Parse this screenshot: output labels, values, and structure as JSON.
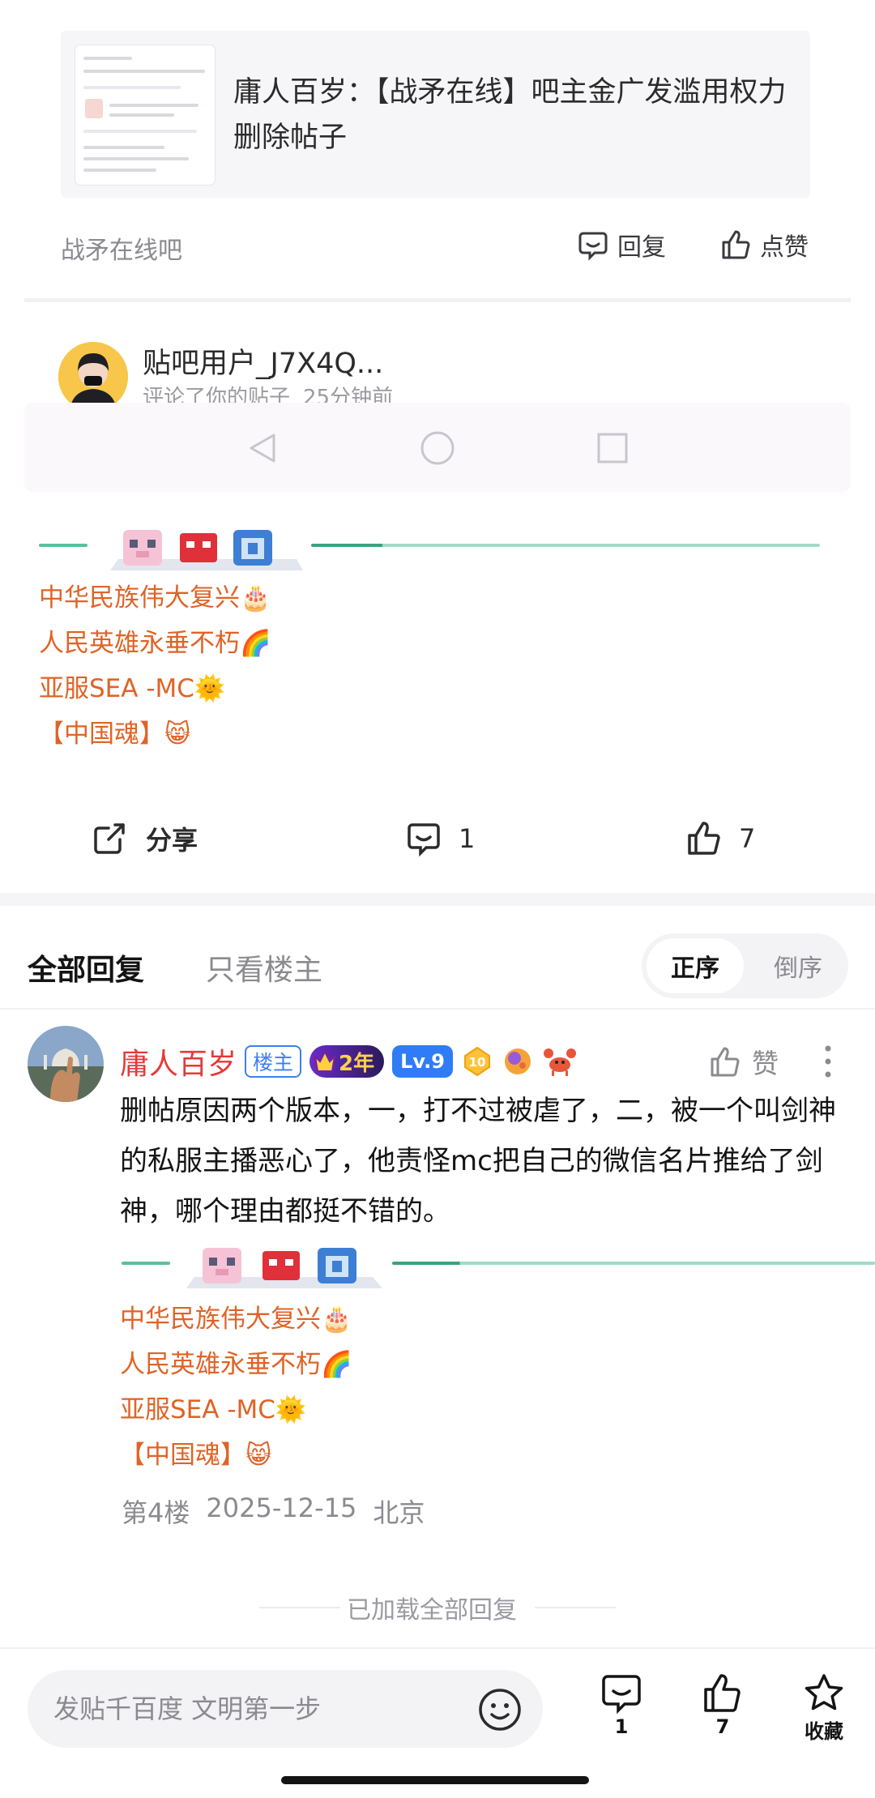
{
  "quoted_post": {
    "title": "庸人百岁：【战矛在线】吧主金广发滥用权力删除帖子",
    "forum": "战矛在线吧",
    "reply_label": "回复",
    "like_label": "点赞"
  },
  "notification": {
    "username": "贴吧用户_J7X4Q...",
    "action": "评论了你的贴子",
    "time": "25分钟前"
  },
  "signature": {
    "line1": "中华民族伟大复兴🎂",
    "line2": "人民英雄永垂不朽🌈",
    "line3": "亚服SEA -MC🌞",
    "line4": "【中国魂】😸"
  },
  "post_actions": {
    "share_label": "分享",
    "comment_count": "1",
    "like_count": "7"
  },
  "reply_tabs": {
    "all": "全部回复",
    "op_only": "只看楼主",
    "order_asc": "正序",
    "order_desc": "倒序"
  },
  "reply": {
    "author": "庸人百岁",
    "op_badge": "楼主",
    "years_badge": "2年",
    "level_badge": "Lv.9",
    "medal_number": "10",
    "like_label": "赞",
    "content": "删帖原因两个版本，一，打不过被虐了，二，被一个叫剑神的私服主播恶心了，他责怪mc把自己的微信名片推给了剑神，哪个理由都挺不错的。",
    "floor": "第4楼",
    "date": "2025-12-15",
    "location": "北京"
  },
  "footer_note": "已加载全部回复",
  "bottom_bar": {
    "input_placeholder": "发贴千百度 文明第一步",
    "comment_count": "1",
    "like_count": "7",
    "favorite_label": "收藏"
  },
  "colors": {
    "signature_orange": "#e06326",
    "author_red": "#e33a3a",
    "op_badge_blue": "#3f7ef0",
    "divider_green": "#5bbf9c"
  }
}
